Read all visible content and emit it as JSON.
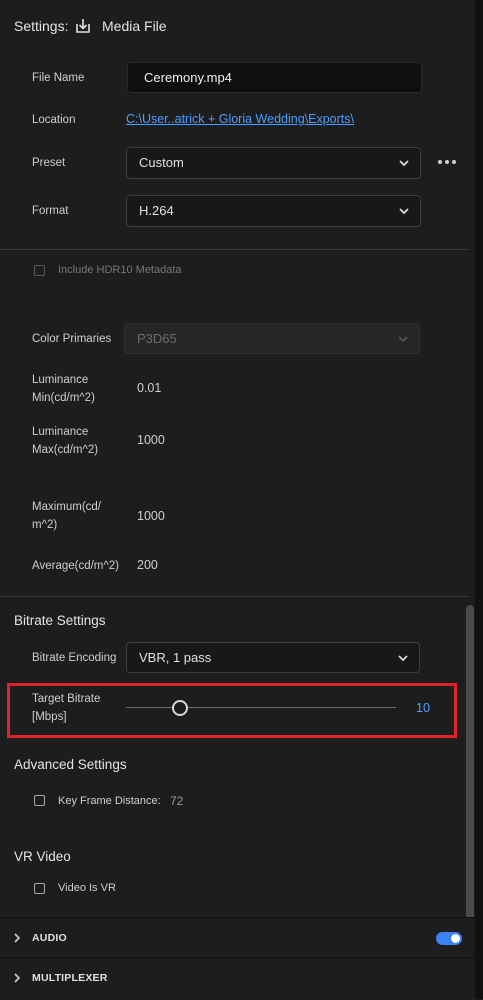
{
  "header": {
    "title": "Settings:",
    "media_label": "Media File"
  },
  "file_name": {
    "label": "File Name",
    "value": "Ceremony.mp4"
  },
  "location": {
    "label": "Location",
    "path": "C:\\User..atrick + Gloria Wedding\\Exports\\"
  },
  "preset": {
    "label": "Preset",
    "value": "Custom"
  },
  "format": {
    "label": "Format",
    "value": "H.264"
  },
  "hdr": {
    "label": "Include HDR10 Metadata",
    "checked": false
  },
  "color_primaries": {
    "label": "Color Primaries",
    "value": "P3D65"
  },
  "lum_min": {
    "label_l1": "Luminance",
    "label_l2": "Min(cd/m^2)",
    "value": "0.01"
  },
  "lum_max": {
    "label_l1": "Luminance",
    "label_l2": "Max(cd/m^2)",
    "value": "1000"
  },
  "maximum": {
    "label_l1": "Maximum(cd/",
    "label_l2": "m^2)",
    "value": "1000"
  },
  "average": {
    "label": "Average(cd/m^2)",
    "value": "200"
  },
  "bitrate": {
    "section": "Bitrate Settings",
    "encoding_label": "Bitrate Encoding",
    "encoding_value": "VBR, 1 pass",
    "target_l1": "Target Bitrate",
    "target_l2": "[Mbps]",
    "target_value": "10",
    "slider_fraction": 0.2
  },
  "advanced": {
    "section": "Advanced Settings",
    "keyframe_label": "Key Frame Distance:",
    "keyframe_value": "72"
  },
  "vr": {
    "section": "VR Video",
    "checkbox_label": "Video Is VR"
  },
  "audio": {
    "label": "AUDIO",
    "enabled": true
  },
  "multiplexer": {
    "label": "MULTIPLEXER"
  },
  "colors": {
    "accent": "#4a9eff",
    "highlight": "#e0232b",
    "toggle": "#3b82f6"
  }
}
